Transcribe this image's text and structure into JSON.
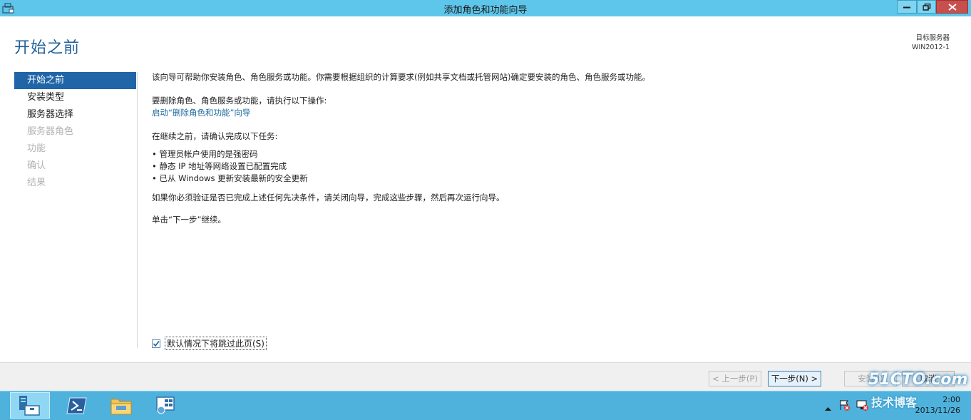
{
  "window": {
    "title": "添加角色和功能向导"
  },
  "page": {
    "title": "开始之前",
    "target_label": "目标服务器",
    "target_value": "WIN2012-1"
  },
  "nav": {
    "items": [
      {
        "label": "开始之前",
        "state": "active"
      },
      {
        "label": "安装类型",
        "state": "enabled"
      },
      {
        "label": "服务器选择",
        "state": "enabled"
      },
      {
        "label": "服务器角色",
        "state": "disabled"
      },
      {
        "label": "功能",
        "state": "disabled"
      },
      {
        "label": "确认",
        "state": "disabled"
      },
      {
        "label": "结果",
        "state": "disabled"
      }
    ]
  },
  "content": {
    "intro": "该向导可帮助你安装角色、角色服务或功能。你需要根据组织的计算要求(例如共享文档或托管网站)确定要安装的角色、角色服务或功能。",
    "remove_heading": "要删除角色、角色服务或功能，请执行以下操作:",
    "remove_link": "启动“删除角色和功能”向导",
    "prereq_heading": "在继续之前，请确认完成以下任务:",
    "prereqs": [
      "管理员帐户使用的是强密码",
      "静态 IP 地址等网络设置已配置完成",
      "已从 Windows 更新安装最新的安全更新"
    ],
    "verify_text": "如果你必须验证是否已完成上述任何先决条件，请关闭向导，完成这些步骤，然后再次运行向导。",
    "continue_text": "单击“下一步”继续。",
    "skip_label": "默认情况下将跳过此页(S)",
    "skip_checked": true
  },
  "footer": {
    "prev_label": "< 上一步(P)",
    "next_label": "下一步(N) >",
    "install_label": "安装(I)",
    "cancel_label": "取消"
  },
  "taskbar": {
    "items": [
      "server-manager-icon",
      "powershell-icon",
      "file-explorer-icon",
      "server-roles-icon"
    ],
    "clock_time": "2:00",
    "clock_date": "2013/11/26"
  },
  "watermark": {
    "line1": "51CTO.com",
    "line2": "技术博客"
  },
  "colors": {
    "accent": "#1f65a8",
    "title_blue": "#1f5f98",
    "titlebar": "#5ec6ea",
    "close": "#c7504f",
    "taskbar": "#4eb2dd"
  }
}
